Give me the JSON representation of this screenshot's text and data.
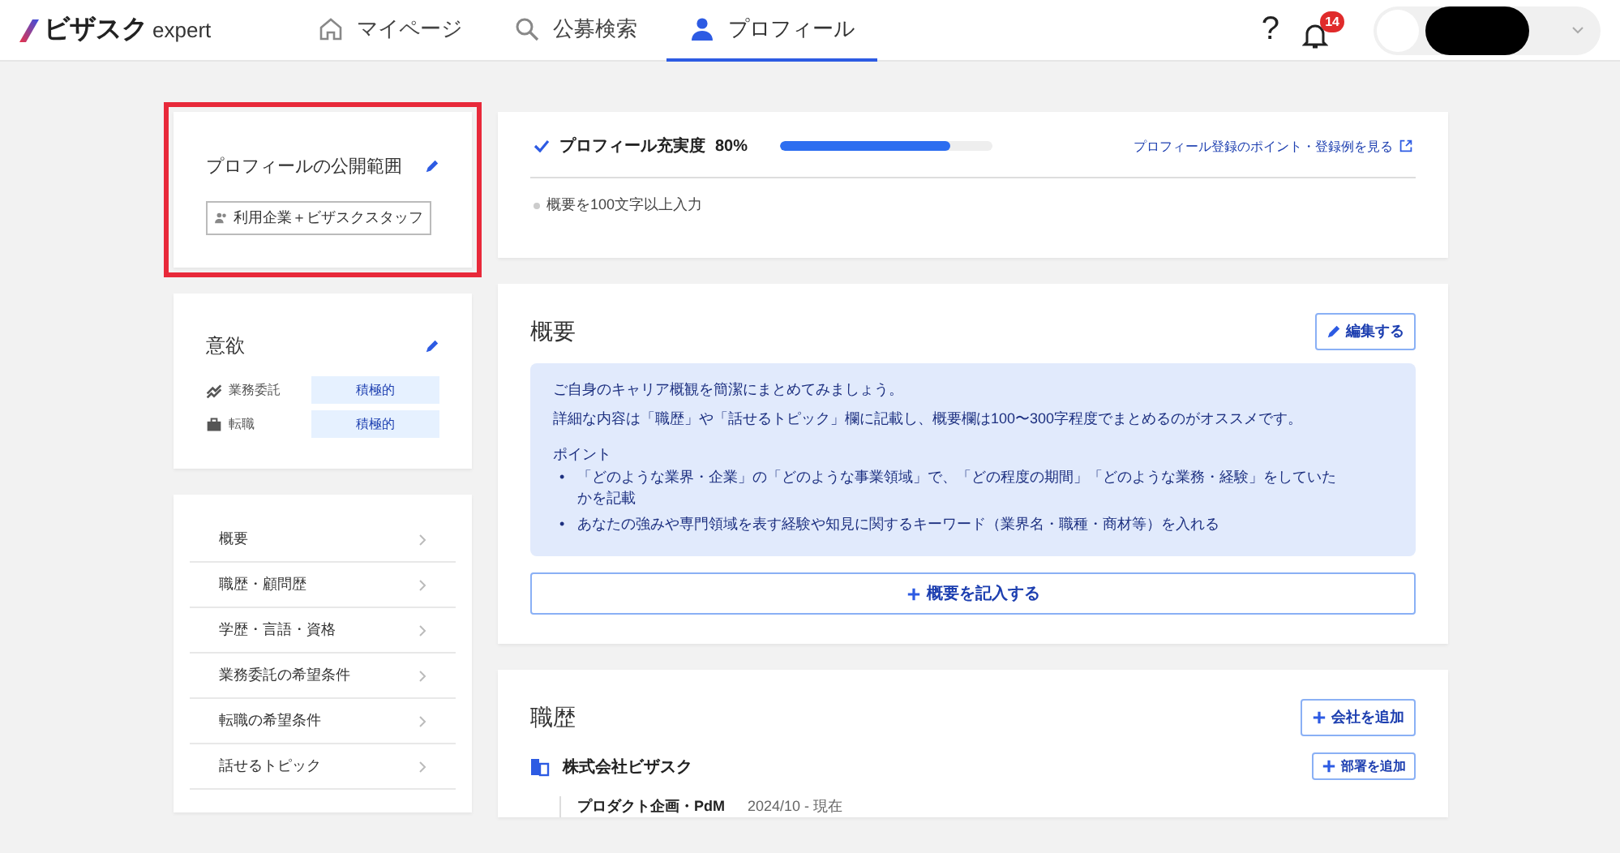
{
  "header": {
    "logo": "ビザスク",
    "logo_suffix": "expert",
    "nav": [
      {
        "label": "マイページ",
        "kind": "home",
        "selected": false
      },
      {
        "label": "公募検索",
        "kind": "search",
        "selected": false
      },
      {
        "label": "プロフィール",
        "kind": "person",
        "selected": true
      }
    ],
    "help": "?",
    "notifications": {
      "count": "14"
    }
  },
  "sidebar": {
    "visibility": {
      "title": "プロフィールの公開範囲",
      "value": "利用企業＋ビザスクスタッフ",
      "highlighted": true
    },
    "motivation": {
      "title": "意欲",
      "items": [
        {
          "label": "業務委託",
          "kind": "freelance",
          "value": "積極的"
        },
        {
          "label": "転職",
          "kind": "job_change",
          "value": "積極的"
        }
      ]
    },
    "menu": [
      {
        "label": "概要"
      },
      {
        "label": "職歴・顧問歴"
      },
      {
        "label": "学歴・言語・資格"
      },
      {
        "label": "業務委託の希望条件"
      },
      {
        "label": "転職の希望条件"
      },
      {
        "label": "話せるトピック"
      }
    ]
  },
  "completeness": {
    "label": "プロフィール充実度",
    "value": "80%",
    "level": 0.8,
    "link": "プロフィール登録のポイント・登録例を見る",
    "todo": [
      "概要を100文字以上入力"
    ]
  },
  "summary": {
    "title": "概要",
    "edit": "編集する",
    "hint_lines": [
      "ご自身のキャリア概観を簡潔にまとめてみましょう。",
      "詳細な内容は「職歴」や「話せるトピック」欄に記載し、概要欄は100〜300字程度でまとめるのがオススメです。"
    ],
    "points_title": "ポイント",
    "bullet": "•",
    "points": [
      "「どのような業界・企業」の「どのような事業領域」で、「どの程度の期間」「どのような業務・経験」をしていたかを記載",
      "あなたの強みや専門領域を表す経験や知見に関するキーワード（業界名・職種・商材等）を入れる"
    ],
    "add": "概要を記入する"
  },
  "career": {
    "title": "職歴",
    "add_company": "会社を追加",
    "companies": [
      {
        "name": "株式会社ビザスク",
        "add_department": "部署を追加",
        "roles": [
          {
            "title": "プロダクト企画・PdM",
            "period": "2024/10 - 現在"
          }
        ]
      }
    ]
  }
}
